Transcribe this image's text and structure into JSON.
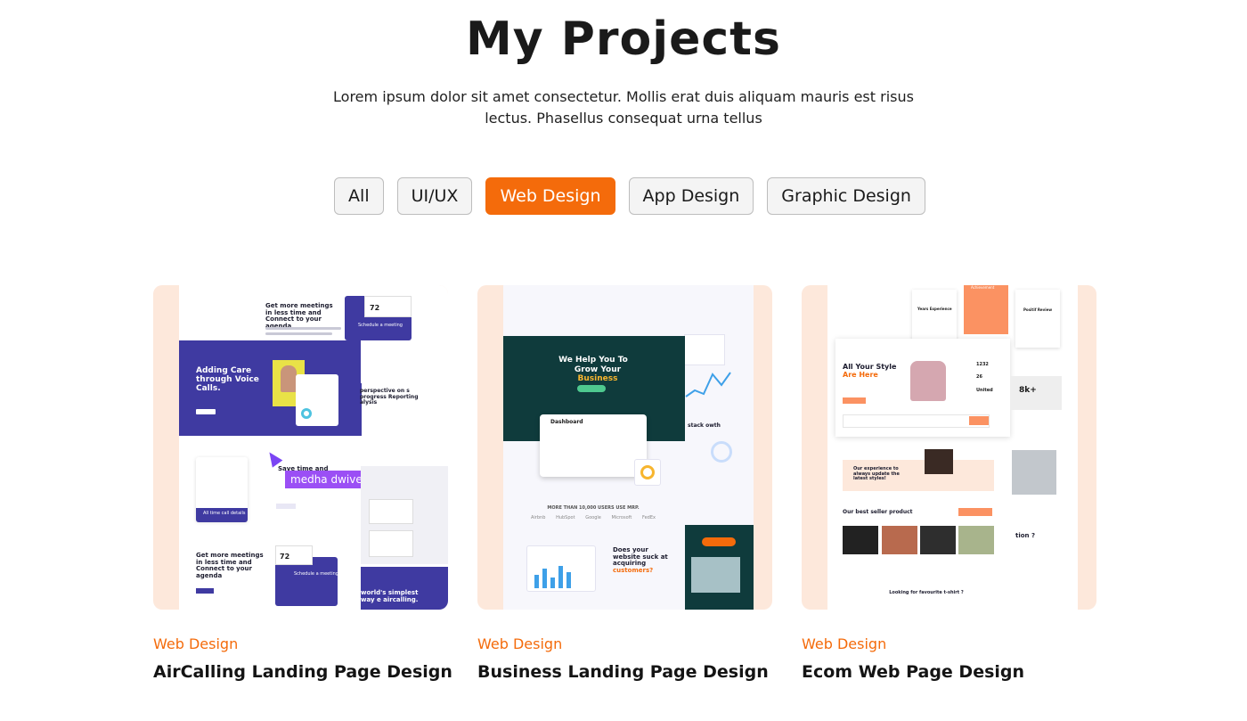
{
  "header": {
    "title": "My Projects",
    "description": "Lorem ipsum dolor sit amet consectetur. Mollis erat duis aliquam mauris est risus lectus. Phasellus consequat urna tellus"
  },
  "filters": [
    {
      "label": "All",
      "active": false
    },
    {
      "label": "UI/UX",
      "active": false
    },
    {
      "label": "Web Design",
      "active": true
    },
    {
      "label": "App Design",
      "active": false
    },
    {
      "label": "Graphic Design",
      "active": false
    }
  ],
  "colors": {
    "accent": "#f46b0b",
    "thumb_bg": "#fde8db"
  },
  "projects": [
    {
      "category": "Web Design",
      "title": "AirCalling Landing Page Design",
      "mock": {
        "hero_heading": "Adding Care through Voice Calls.",
        "top_heading": "Get more meetings in less time and Connect to your agenda",
        "count": "72",
        "schedule": "Schedule a meeting",
        "perspective": "perspective on s progress Reporting alysis",
        "user_tag": "medha dwivedi",
        "save_text": "Save time and",
        "all_calls": "All time call details",
        "bottom_heading": "Get more meetings in less time and Connect to your agenda",
        "bottom_count": "72",
        "bottom_schedule": "Schedule a meeting",
        "world_text": "world's simplest way e aircalling."
      }
    },
    {
      "category": "Web Design",
      "title": "Business Landing Page Design",
      "mock": {
        "hero_heading": "We Help You To",
        "hero_heading2": "Grow Your",
        "hero_highlight": "Business",
        "dashboard": "Dashboard",
        "users_text": "MORE THAN 10,000 USERS USE MRP.",
        "stack_text": "stack owth",
        "suck_text": "Does your website suck at acquiring",
        "suck_highlight": "customers?",
        "brands": [
          "Airbnb",
          "HubSpot",
          "Google",
          "Microsoft",
          "FedEx"
        ]
      }
    },
    {
      "category": "Web Design",
      "title": "Ecom Web Page Design",
      "mock": {
        "hero_heading": "All Your Style",
        "hero_highlight": "Are Here",
        "stat1": "1232",
        "stat2": "26",
        "stat3": "United",
        "stat_big": "8k+",
        "years": "Years Experience",
        "achievement": "Achievement",
        "review": "Positif Review",
        "experience_text": "Our experience to always update the latest styles!",
        "best_seller": "Our best seller product",
        "question": "tion ?",
        "looking": "Looking for favourite t-shirt ?"
      }
    }
  ]
}
